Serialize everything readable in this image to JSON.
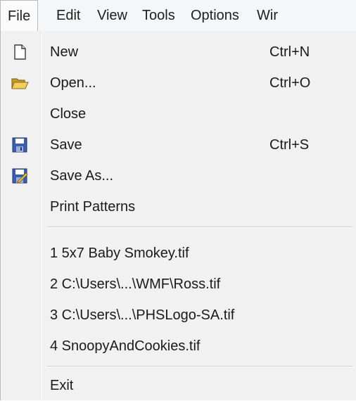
{
  "menubar": {
    "items": [
      {
        "label": "File",
        "open": true
      },
      {
        "label": "Edit"
      },
      {
        "label": "View"
      },
      {
        "label": "Tools"
      },
      {
        "label": "Options"
      },
      {
        "label": "Wir"
      }
    ]
  },
  "file_menu": {
    "items": [
      {
        "label": "New",
        "shortcut": "Ctrl+N",
        "icon": "new-document-icon"
      },
      {
        "label": "Open...",
        "shortcut": "Ctrl+O",
        "icon": "open-folder-icon"
      },
      {
        "label": "Close",
        "shortcut": "",
        "icon": ""
      },
      {
        "label": "Save",
        "shortcut": "Ctrl+S",
        "icon": "floppy-disk-icon"
      },
      {
        "label": "Save As...",
        "shortcut": "",
        "icon": "save-as-icon"
      },
      {
        "label": "Print Patterns",
        "shortcut": "",
        "icon": ""
      }
    ],
    "recent_files": [
      {
        "label": "1 5x7 Baby Smokey.tif"
      },
      {
        "label": "2 C:\\Users\\...\\WMF\\Ross.tif"
      },
      {
        "label": "3 C:\\Users\\...\\PHSLogo-SA.tif"
      },
      {
        "label": "4 SnoopyAndCookies.tif"
      }
    ],
    "exit_label": "Exit"
  },
  "colors": {
    "menu_bg": "#f1f1f1",
    "menubar_bg": "#f5f6f7",
    "floppy_blue": "#3a5fb0",
    "folder_yellow": "#e8c24a"
  }
}
